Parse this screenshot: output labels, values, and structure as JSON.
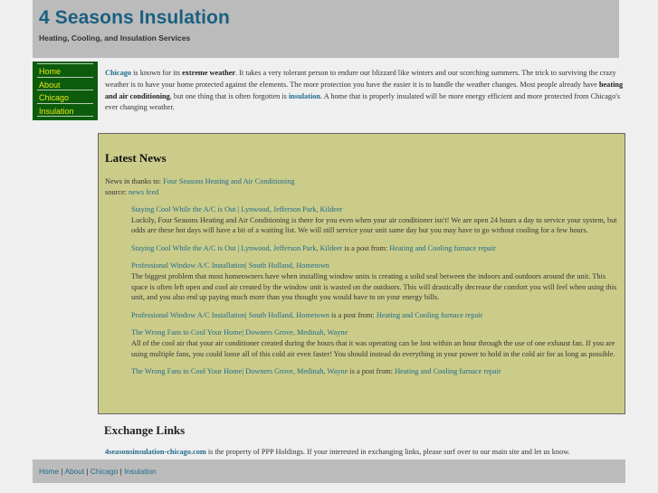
{
  "header": {
    "title": "4 Seasons Insulation",
    "tagline": "Heating, Cooling, and Insulation Services"
  },
  "nav": {
    "items": [
      {
        "label": "Home"
      },
      {
        "label": "About"
      },
      {
        "label": "Chicago"
      },
      {
        "label": "Insulation"
      }
    ]
  },
  "intro": {
    "chicago_link": "Chicago",
    "t1": " is known for its ",
    "b1": "extreme weather",
    "t2": ". It takes a very tolerant person to endure our blizzard like winters and our scorching summers. The trick to surviving the crazy weather is to have your home protected against the elements. The more protection you have the easier it is to handle the weather changes. Most people already have ",
    "b2": "heating and air conditioning",
    "t3": ", but one thing that is often forgotten is ",
    "insulation_link": "insulation",
    "t4": ". A home that is properly insulated will be more energy efficient and more protected from Chicago's ever changing weather."
  },
  "news": {
    "heading": "Latest News",
    "thanks_label": "News in thanks to: ",
    "thanks_link": "Four Seasons Heating and Air Conditioning",
    "source_label": "source: ",
    "source_link": "news feed",
    "post_from_label": " is a post from: ",
    "items": [
      {
        "title": "Staying Cool While the A/C is Out | Lynwood, Jefferson Park, Kildeer",
        "body": "Luckily, Four Seasons Heating and Air Conditioning is there for you even when your air conditioner isn't! We are open 24 hours a day to service your system, but odds are these hot days will have a bit of a waiting list. We will still service your unit same day but you may have to go without cooling for a few hours.",
        "source": "Heating and Cooling furnace repair"
      },
      {
        "title": "Professional Window A/C Installation| South Holland, Hometown",
        "body": "The biggest problem that most homeowners have when installing window units is creating a solid seal between the indoors and outdoors around the unit. This space is often left open and cool air created by the window unit is wasted on the outdoors. This will drastically decrease the comfort you will feel when using this unit, and you also end up paying much more than you thought you would have to on your energy bills.",
        "source": "Heating and Cooling furnace repair"
      },
      {
        "title": "The Wrong Fans to Cool Your Home| Downers Grove, Medinah, Wayne",
        "body": "All of the cool air that your air conditioner created during the hours that it was operating can be lost within an hour through the use of one exhaust fan. If you are using multiple fans, you could loose all of this cold air even faster! You should instead do everything in your power to hold in the cold air for as long as possible.",
        "source": "Heating and Cooling furnace repair"
      }
    ]
  },
  "exchange": {
    "heading": "Exchange Links",
    "site_link": "4seasonsinsulation-chicago.com",
    "text": " is the property of PPP Holdings. If your interested in exchanging links, please surf over to our main site and let us know."
  },
  "footer": {
    "links": [
      {
        "label": "Home"
      },
      {
        "label": "About"
      },
      {
        "label": "Chicago"
      },
      {
        "label": "Insulation"
      }
    ],
    "separator": " | "
  },
  "colors": {
    "link": "#1f6b8a",
    "title": "#1a5f80",
    "nav_bg": "#0c5c0c",
    "nav_text": "#e8e81a",
    "news_bg": "#cccc8a",
    "header_bg": "#bbbbbb",
    "page_bg": "#efefef"
  }
}
